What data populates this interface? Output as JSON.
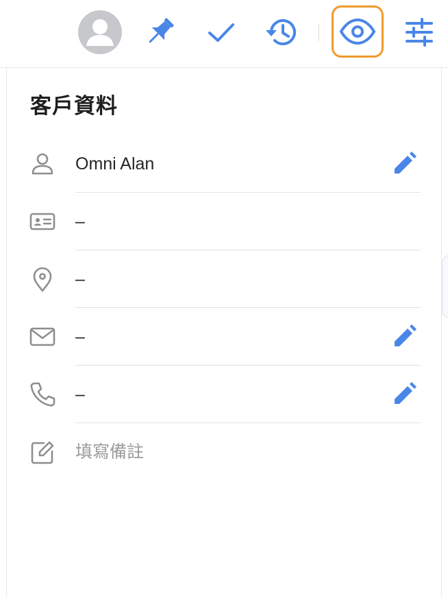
{
  "toolbar": {
    "icons": [
      "avatar",
      "pin-icon",
      "check-icon",
      "history-icon",
      "eye-icon",
      "tune-icon"
    ],
    "accent_color": "#4a86e8",
    "highlight_color": "#ee9a2b"
  },
  "panel": {
    "title": "客戶資料",
    "rows": [
      {
        "icon": "person-icon",
        "value": "Omni Alan",
        "editable": true
      },
      {
        "icon": "id-card-icon",
        "value": "–",
        "editable": false
      },
      {
        "icon": "location-icon",
        "value": "–",
        "editable": false
      },
      {
        "icon": "mail-icon",
        "value": "–",
        "editable": true
      },
      {
        "icon": "phone-icon",
        "value": "–",
        "editable": true
      },
      {
        "icon": "note-icon",
        "placeholder": "填寫備註",
        "editable": false
      }
    ]
  }
}
